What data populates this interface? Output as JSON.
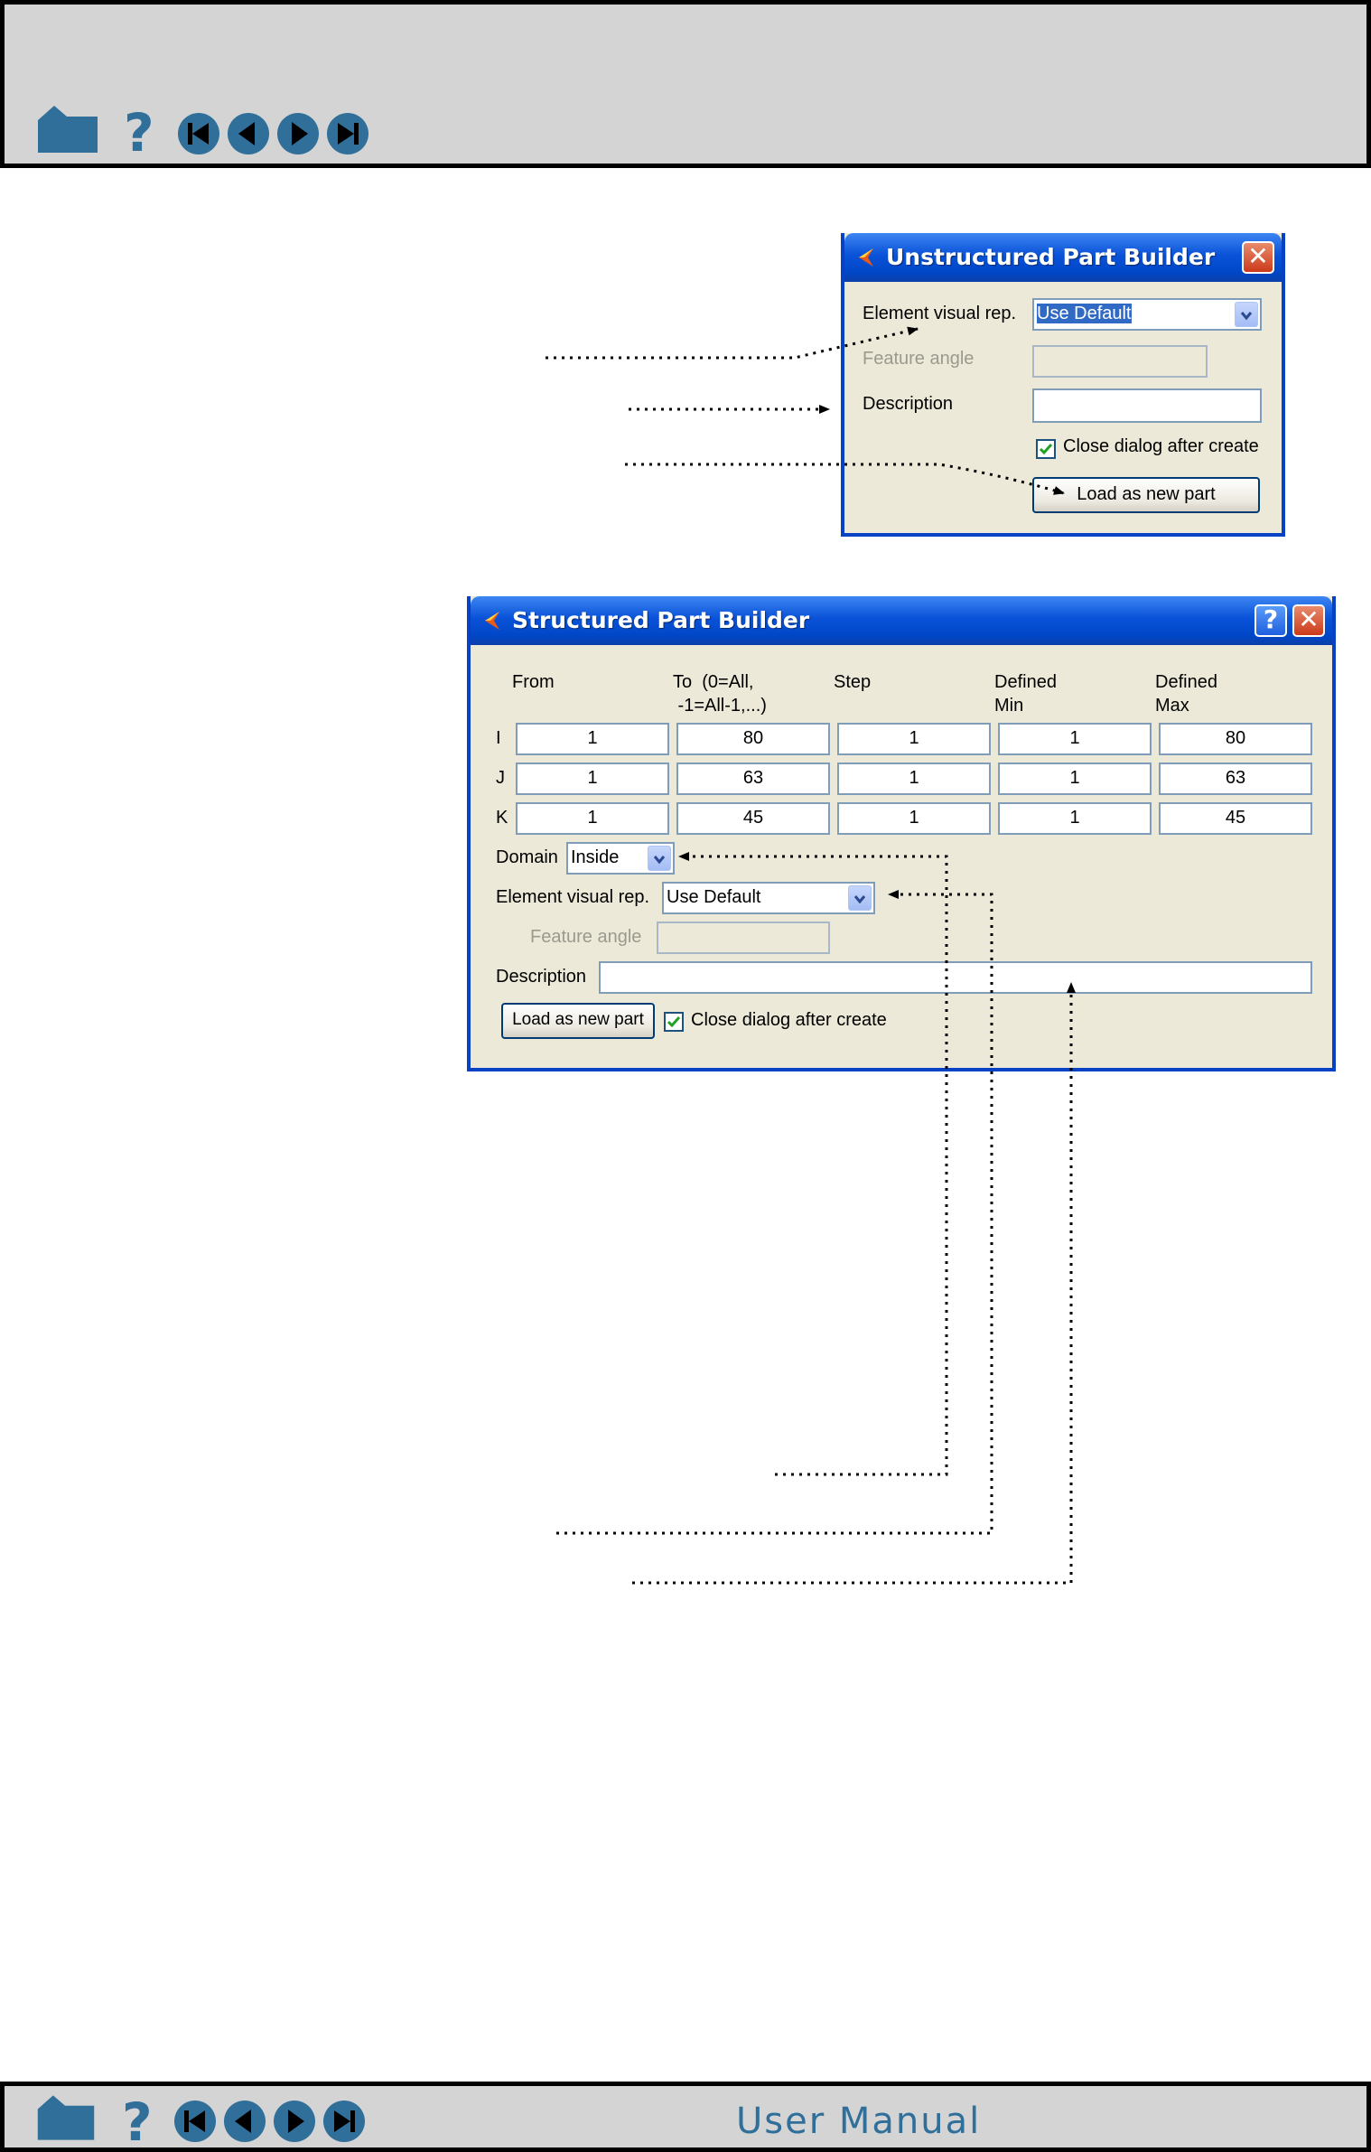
{
  "nav": {
    "icons": [
      "home-icon",
      "help-icon",
      "first-page-icon",
      "previous-page-icon",
      "next-page-icon",
      "last-page-icon"
    ],
    "color": "#2f6f9a",
    "footer_title": "User Manual"
  },
  "unstructured_dialog": {
    "title": "Unstructured Part Builder",
    "element_visual_rep_label": "Element visual rep.",
    "element_visual_rep_value": "Use Default",
    "feature_angle_label": "Feature angle",
    "description_label": "Description",
    "close_after_create_label": "Close dialog after create",
    "close_after_create_checked": true,
    "load_button": "Load as new part"
  },
  "structured_dialog": {
    "title": "Structured Part Builder",
    "columns": [
      "From",
      "To  (0=All,\n -1=All-1,...)",
      "Step",
      "Defined\nMin",
      "Defined\nMax"
    ],
    "rows": [
      {
        "axis": "I",
        "values": [
          "1",
          "80",
          "1",
          "1",
          "80"
        ]
      },
      {
        "axis": "J",
        "values": [
          "1",
          "63",
          "1",
          "1",
          "63"
        ]
      },
      {
        "axis": "K",
        "values": [
          "1",
          "45",
          "1",
          "1",
          "45"
        ]
      }
    ],
    "domain_label": "Domain",
    "domain_value": "Inside",
    "element_visual_rep_label": "Element visual rep.",
    "element_visual_rep_value": "Use Default",
    "feature_angle_label": "Feature angle",
    "description_label": "Description",
    "load_button": "Load as new part",
    "close_after_create_label": "Close dialog after create",
    "close_after_create_checked": true
  }
}
